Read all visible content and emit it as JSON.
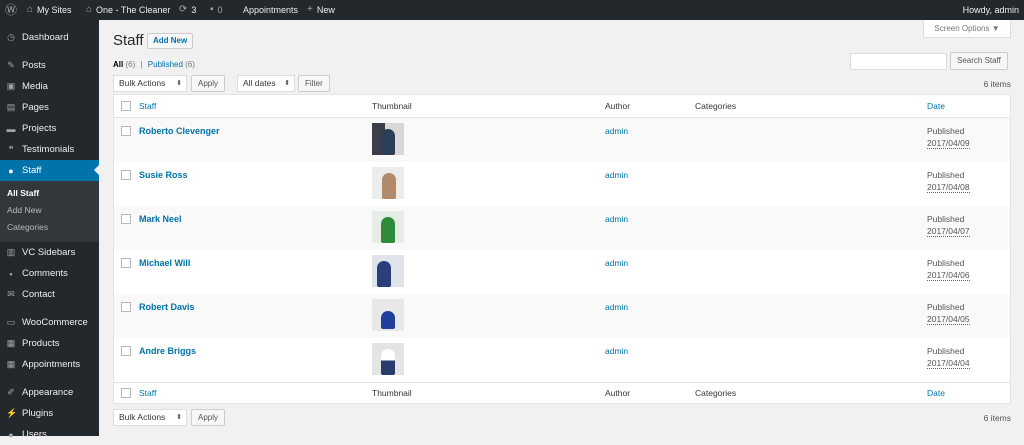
{
  "adminbar": {
    "wp_logo": "wordpress-icon",
    "my_sites": "My Sites",
    "site_name": "One - The Cleaner",
    "updates_count": "3",
    "comments_count": "0",
    "appointments": "Appointments",
    "new": "New",
    "howdy": "Howdy, admin"
  },
  "menu": {
    "dashboard": "Dashboard",
    "posts": "Posts",
    "media": "Media",
    "pages": "Pages",
    "projects": "Projects",
    "testimonials": "Testimonials",
    "staff": "Staff",
    "sub_all_staff": "All Staff",
    "sub_add_new": "Add New",
    "sub_categories": "Categories",
    "vc_sidebars": "VC Sidebars",
    "comments": "Comments",
    "contact": "Contact",
    "woocommerce": "WooCommerce",
    "products": "Products",
    "appointments": "Appointments",
    "appearance": "Appearance",
    "plugins": "Plugins",
    "users": "Users"
  },
  "page": {
    "title": "Staff",
    "add_new": "Add New",
    "screen_options": "Screen Options ▼",
    "filter_all": "All",
    "filter_all_count": "(6)",
    "separator": "|",
    "filter_published": "Published",
    "filter_published_count": "(6)",
    "search_button": "Search Staff",
    "bulk_actions": "Bulk Actions",
    "apply": "Apply",
    "all_dates": "All dates",
    "filter_button": "Filter",
    "items_count": "6 items"
  },
  "table": {
    "col_staff": "Staff",
    "col_thumbnail": "Thumbnail",
    "col_author": "Author",
    "col_categories": "Categories",
    "col_date": "Date",
    "rows": [
      {
        "name": "Roberto Clevenger",
        "author": "admin",
        "status": "Published",
        "date": "2017/04/09"
      },
      {
        "name": "Susie Ross",
        "author": "admin",
        "status": "Published",
        "date": "2017/04/08"
      },
      {
        "name": "Mark Neel",
        "author": "admin",
        "status": "Published",
        "date": "2017/04/07"
      },
      {
        "name": "Michael Will",
        "author": "admin",
        "status": "Published",
        "date": "2017/04/06"
      },
      {
        "name": "Robert Davis",
        "author": "admin",
        "status": "Published",
        "date": "2017/04/05"
      },
      {
        "name": "Andre Briggs",
        "author": "admin",
        "status": "Published",
        "date": "2017/04/04"
      }
    ]
  },
  "colors": {
    "accent": "#0073aa",
    "adminbar": "#23282d",
    "sidebar": "#23282d"
  }
}
